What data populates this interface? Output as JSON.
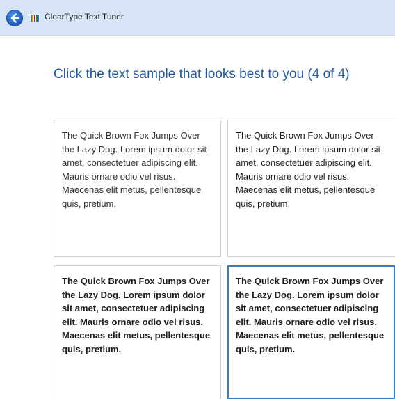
{
  "window": {
    "title": "ClearType Text Tuner",
    "accent_color": "#1f5aa6",
    "back_icon": "back-arrow-icon",
    "app_icon": "cleartype-app-icon"
  },
  "heading": "Click the text sample that looks best to you (4 of 4)",
  "samples": [
    {
      "text": "The Quick Brown Fox Jumps Over the Lazy Dog. Lorem ipsum dolor sit amet, consectetuer adipiscing elit. Mauris ornare odio vel risus. Maecenas elit metus, pellentesque quis, pretium.",
      "selected": false
    },
    {
      "text": "The Quick Brown Fox Jumps Over the Lazy Dog. Lorem ipsum dolor sit amet, consectetuer adipiscing elit. Mauris ornare odio vel risus. Maecenas elit metus, pellentesque quis, pretium.",
      "selected": false
    },
    {
      "text": "The Quick Brown Fox Jumps Over the Lazy Dog. Lorem ipsum dolor sit amet, consectetuer adipiscing elit. Mauris ornare odio vel risus. Maecenas elit metus, pellentesque quis, pretium.",
      "selected": false
    },
    {
      "text": "The Quick Brown Fox Jumps Over the Lazy Dog. Lorem ipsum dolor sit amet, consectetuer adipiscing elit. Mauris ornare odio vel risus. Maecenas elit metus, pellentesque quis, pretium.",
      "selected": true
    }
  ]
}
